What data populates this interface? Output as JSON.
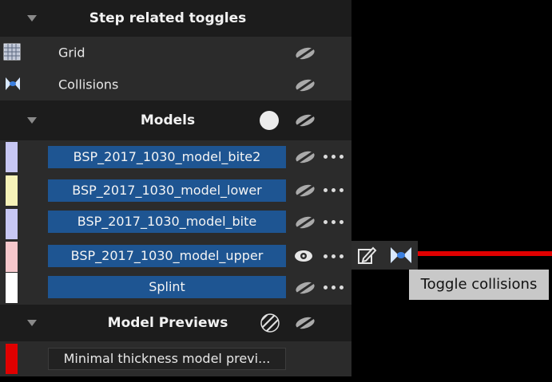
{
  "step_toggles": {
    "title": "Step related toggles",
    "items": [
      {
        "label": "Grid",
        "icon": "grid-icon"
      },
      {
        "label": "Collisions",
        "icon": "collision-icon"
      }
    ]
  },
  "models": {
    "title": "Models",
    "items": [
      {
        "name": "BSP_2017_1030_model_bite2",
        "color": "#c8c8f4",
        "visible": false
      },
      {
        "name": "BSP_2017_1030_model_lower",
        "color": "#f6f2b8",
        "visible": false
      },
      {
        "name": "BSP_2017_1030_model_bite",
        "color": "#c8c8f4",
        "visible": false
      },
      {
        "name": "BSP_2017_1030_model_upper",
        "color": "#f6c8cc",
        "visible": true
      },
      {
        "name": "Splint",
        "color": "#ffffff",
        "visible": false
      }
    ]
  },
  "model_previews": {
    "title": "Model Previews",
    "items": [
      {
        "name": "Minimal thickness model previ...",
        "color": "#e00000"
      }
    ]
  },
  "tooltip": {
    "text": "Toggle collisions"
  },
  "colors": {
    "accent_button": "#1e5592",
    "header_bg": "#1c1c1c",
    "panel_bg": "#2b2b2b",
    "collision_line": "#e00000"
  }
}
